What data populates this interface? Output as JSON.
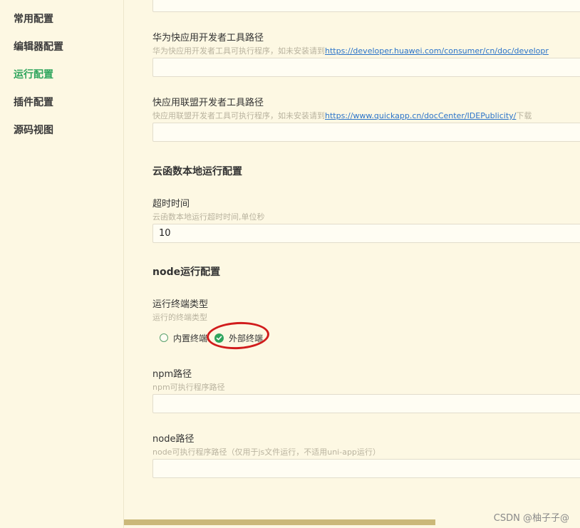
{
  "sidebar": {
    "items": [
      {
        "label": "常用配置"
      },
      {
        "label": "编辑器配置"
      },
      {
        "label": "运行配置"
      },
      {
        "label": "插件配置"
      },
      {
        "label": "源码视图"
      }
    ]
  },
  "fields": {
    "huawei": {
      "title": "华为快应用开发者工具路径",
      "desc_prefix": "华为快应用开发者工具可执行程序，如未安装请到",
      "link": "https://developer.huawei.com/consumer/cn/doc/developr",
      "value": ""
    },
    "quickapp": {
      "title": "快应用联盟开发者工具路径",
      "desc_prefix": "快应用联盟开发者工具可执行程序，如未安装请到",
      "link": "https://www.quickapp.cn/docCenter/IDEPublicity/",
      "desc_suffix": "下载",
      "value": ""
    },
    "cloud_section": {
      "title": "云函数本地运行配置"
    },
    "timeout": {
      "title": "超时时间",
      "desc": "云函数本地运行超时时间,单位秒",
      "value": "10"
    },
    "node_section": {
      "title": "node运行配置"
    },
    "terminal": {
      "title": "运行终端类型",
      "desc": "运行的终端类型",
      "options": [
        {
          "label": "内置终端",
          "selected": false
        },
        {
          "label": "外部终端",
          "selected": true
        }
      ]
    },
    "npm": {
      "title": "npm路径",
      "desc": "npm可执行程序路径",
      "value": ""
    },
    "node": {
      "title": "node路径",
      "desc": "node可执行程序路径（仅用于js文件运行，不适用uni-app运行）",
      "value": ""
    }
  },
  "watermark": "CSDN @柚子子@",
  "colors": {
    "active": "#2fa55d",
    "annotation": "#d11c1c",
    "link": "#2a73c9",
    "background": "#fdf8e3"
  }
}
